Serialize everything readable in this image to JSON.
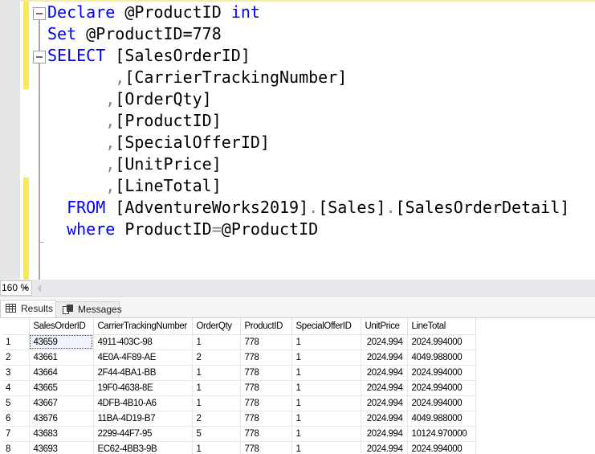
{
  "editor": {
    "lines": [
      {
        "parts": [
          {
            "t": "Declare",
            "c": "kw"
          },
          {
            "t": " @ProductID ",
            "c": ""
          },
          {
            "t": "int",
            "c": "kw"
          }
        ]
      },
      {
        "parts": [
          {
            "t": "Set",
            "c": "kw"
          },
          {
            "t": " @ProductID=778",
            "c": ""
          }
        ]
      },
      {
        "parts": [
          {
            "t": "SELECT",
            "c": "kw"
          },
          {
            "t": " [SalesOrderID]",
            "c": ""
          }
        ]
      },
      {
        "parts": [
          {
            "t": "       ",
            "c": ""
          },
          {
            "t": ",",
            "c": "dot"
          },
          {
            "t": "[CarrierTrackingNumber]",
            "c": ""
          }
        ]
      },
      {
        "parts": [
          {
            "t": "      ",
            "c": ""
          },
          {
            "t": ",",
            "c": "dot"
          },
          {
            "t": "[OrderQty]",
            "c": ""
          }
        ]
      },
      {
        "parts": [
          {
            "t": "      ",
            "c": ""
          },
          {
            "t": ",",
            "c": "dot"
          },
          {
            "t": "[ProductID]",
            "c": ""
          }
        ]
      },
      {
        "parts": [
          {
            "t": "      ",
            "c": ""
          },
          {
            "t": ",",
            "c": "dot"
          },
          {
            "t": "[SpecialOfferID]",
            "c": ""
          }
        ]
      },
      {
        "parts": [
          {
            "t": "      ",
            "c": ""
          },
          {
            "t": ",",
            "c": "dot"
          },
          {
            "t": "[UnitPrice]",
            "c": ""
          }
        ]
      },
      {
        "parts": [
          {
            "t": "      ",
            "c": ""
          },
          {
            "t": ",",
            "c": "dot"
          },
          {
            "t": "[LineTotal]",
            "c": ""
          }
        ]
      },
      {
        "parts": [
          {
            "t": "  ",
            "c": ""
          },
          {
            "t": "FROM",
            "c": "kw"
          },
          {
            "t": " [AdventureWorks2019]",
            "c": ""
          },
          {
            "t": ".",
            "c": "dot"
          },
          {
            "t": "[Sales]",
            "c": ""
          },
          {
            "t": ".",
            "c": "dot"
          },
          {
            "t": "[SalesOrderDetail]",
            "c": ""
          }
        ]
      },
      {
        "parts": [
          {
            "t": "  ",
            "c": ""
          },
          {
            "t": "where",
            "c": "kw"
          },
          {
            "t": " ProductID",
            "c": ""
          },
          {
            "t": "=",
            "c": "dot"
          },
          {
            "t": "@ProductID",
            "c": ""
          }
        ]
      }
    ]
  },
  "zoom": {
    "value": "160 %"
  },
  "results": {
    "tabs": [
      {
        "label": "Results",
        "icon": "grid-icon",
        "active": true
      },
      {
        "label": "Messages",
        "icon": "messages-icon",
        "active": false
      }
    ],
    "columns": [
      "SalesOrderID",
      "CarrierTrackingNumber",
      "OrderQty",
      "ProductID",
      "SpecialOfferID",
      "UnitPrice",
      "LineTotal"
    ],
    "rows": [
      [
        "1",
        "43659",
        "4911-403C-98",
        "1",
        "778",
        "1",
        "2024.994",
        "2024.994000"
      ],
      [
        "2",
        "43661",
        "4E0A-4F89-AE",
        "2",
        "778",
        "1",
        "2024.994",
        "4049.988000"
      ],
      [
        "3",
        "43664",
        "2F44-4BA1-BB",
        "1",
        "778",
        "1",
        "2024.994",
        "2024.994000"
      ],
      [
        "4",
        "43665",
        "19F0-4638-8E",
        "1",
        "778",
        "1",
        "2024.994",
        "2024.994000"
      ],
      [
        "5",
        "43667",
        "4DFB-4B10-A6",
        "1",
        "778",
        "1",
        "2024.994",
        "2024.994000"
      ],
      [
        "6",
        "43676",
        "11BA-4D19-B7",
        "2",
        "778",
        "1",
        "2024.994",
        "4049.988000"
      ],
      [
        "7",
        "43683",
        "2299-44F7-95",
        "5",
        "778",
        "1",
        "2024.994",
        "10124.970000"
      ],
      [
        "8",
        "43693",
        "EC62-4BB3-9B",
        "1",
        "778",
        "1",
        "2024.994",
        "2024.994000"
      ]
    ],
    "selected_cell": {
      "row": 0,
      "col": 1
    }
  },
  "colors": {
    "keyword": "#0000ff",
    "operator": "#808080",
    "change_marker": "#fce94f"
  }
}
